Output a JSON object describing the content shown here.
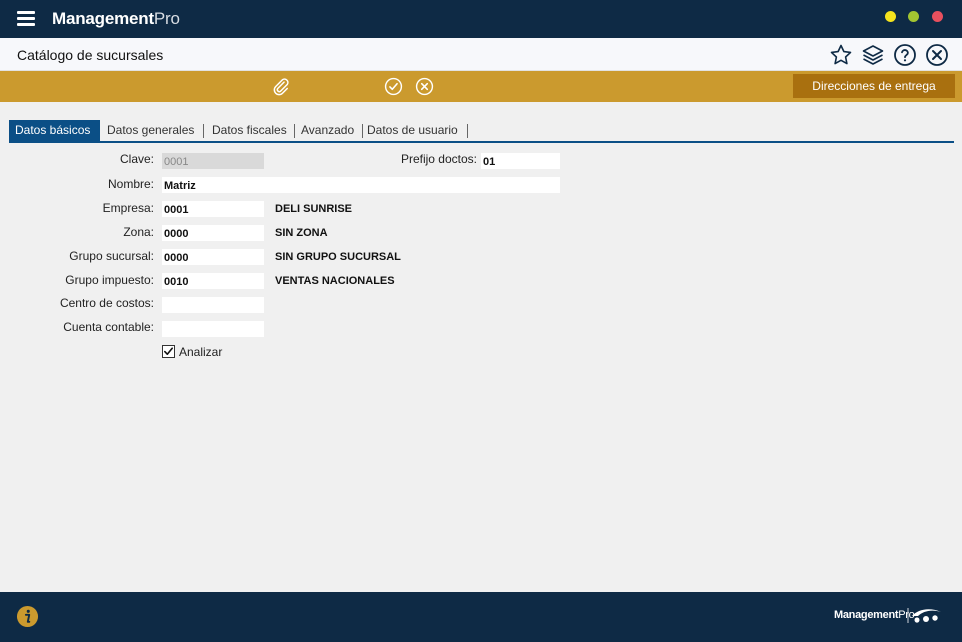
{
  "app": {
    "brand_bold": "Management",
    "brand_light": "Pro"
  },
  "window": {
    "minimize_color": "#f5e31d",
    "maximize_color": "#a3c531",
    "close_color": "#e8505e"
  },
  "header": {
    "title": "Catálogo de sucursales",
    "icons": [
      "star-icon",
      "layers-icon",
      "help-icon",
      "close-circle-icon"
    ]
  },
  "toolbar": {
    "icons": [
      "paperclip-icon",
      "check-circle-icon",
      "cancel-circle-icon"
    ],
    "direcciones_label": "Direcciones de entrega"
  },
  "tabs": [
    {
      "label": "Datos básicos",
      "active": true
    },
    {
      "label": "Datos generales"
    },
    {
      "label": "Datos fiscales"
    },
    {
      "label": "Avanzado"
    },
    {
      "label": "Datos de usuario"
    }
  ],
  "form": {
    "clave": {
      "label": "Clave:",
      "value": "0001"
    },
    "prefijo": {
      "label": "Prefijo doctos:",
      "value": "01"
    },
    "nombre": {
      "label": "Nombre:",
      "value": "Matriz"
    },
    "empresa": {
      "label": "Empresa:",
      "value": "0001",
      "desc": "DELI SUNRISE"
    },
    "zona": {
      "label": "Zona:",
      "value": "0000",
      "desc": "SIN ZONA"
    },
    "grupo_sucursal": {
      "label": "Grupo sucursal:",
      "value": "0000",
      "desc": "SIN GRUPO SUCURSAL"
    },
    "grupo_impuesto": {
      "label": "Grupo impuesto:",
      "value": "0010",
      "desc": "VENTAS NACIONALES"
    },
    "centro_costos": {
      "label": "Centro de costos:",
      "value": ""
    },
    "cuenta_contable": {
      "label": "Cuenta contable:",
      "value": ""
    },
    "analizar": {
      "label": "Analizar",
      "checked": true
    }
  },
  "footer": {
    "brand_bold": "Management",
    "brand_light": "Pro",
    "info_icon": "info-icon"
  },
  "colors": {
    "navy": "#0e2a45",
    "gold": "#cb9a2e",
    "gold_dark": "#a9700f",
    "tab_blue": "#0b4f86"
  }
}
